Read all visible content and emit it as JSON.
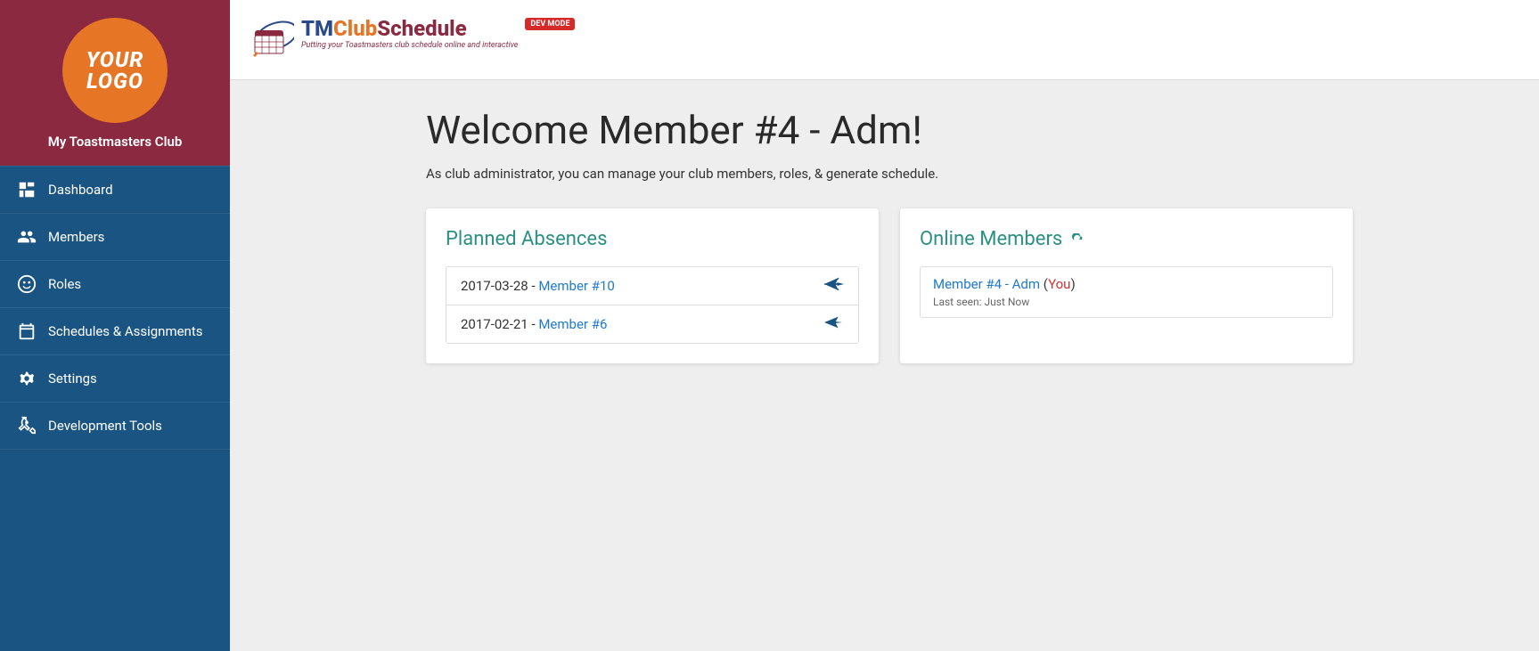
{
  "sidebar": {
    "logo_line1": "YOUR",
    "logo_line2": "LOGO",
    "club_name": "My Toastmasters Club",
    "items": [
      {
        "label": "Dashboard",
        "icon": "dashboard-icon"
      },
      {
        "label": "Members",
        "icon": "members-icon"
      },
      {
        "label": "Roles",
        "icon": "roles-icon"
      },
      {
        "label": "Schedules & Assignments",
        "icon": "calendar-icon"
      },
      {
        "label": "Settings",
        "icon": "gear-icon"
      },
      {
        "label": "Development Tools",
        "icon": "devtools-icon"
      }
    ]
  },
  "topbar": {
    "brand_tm": "TM",
    "brand_club": "Club",
    "brand_schedule": "Schedule",
    "tagline": "Putting your Toastmasters club schedule online and interactive",
    "dev_badge": "DEV MODE"
  },
  "main": {
    "title": "Welcome Member #4 - Adm!",
    "subtitle": "As club administrator, you can manage your club members, roles, & generate schedule."
  },
  "absences": {
    "heading": "Planned Absences",
    "rows": [
      {
        "date": "2017-03-28",
        "sep": " - ",
        "member": "Member #10"
      },
      {
        "date": "2017-02-21",
        "sep": " - ",
        "member": "Member #6"
      }
    ]
  },
  "online": {
    "heading": "Online Members",
    "member": "Member #4 - Adm",
    "open_paren": " (",
    "you": "You",
    "close_paren": ")",
    "last_seen_label": "Last seen: ",
    "last_seen_value": "Just Now"
  }
}
